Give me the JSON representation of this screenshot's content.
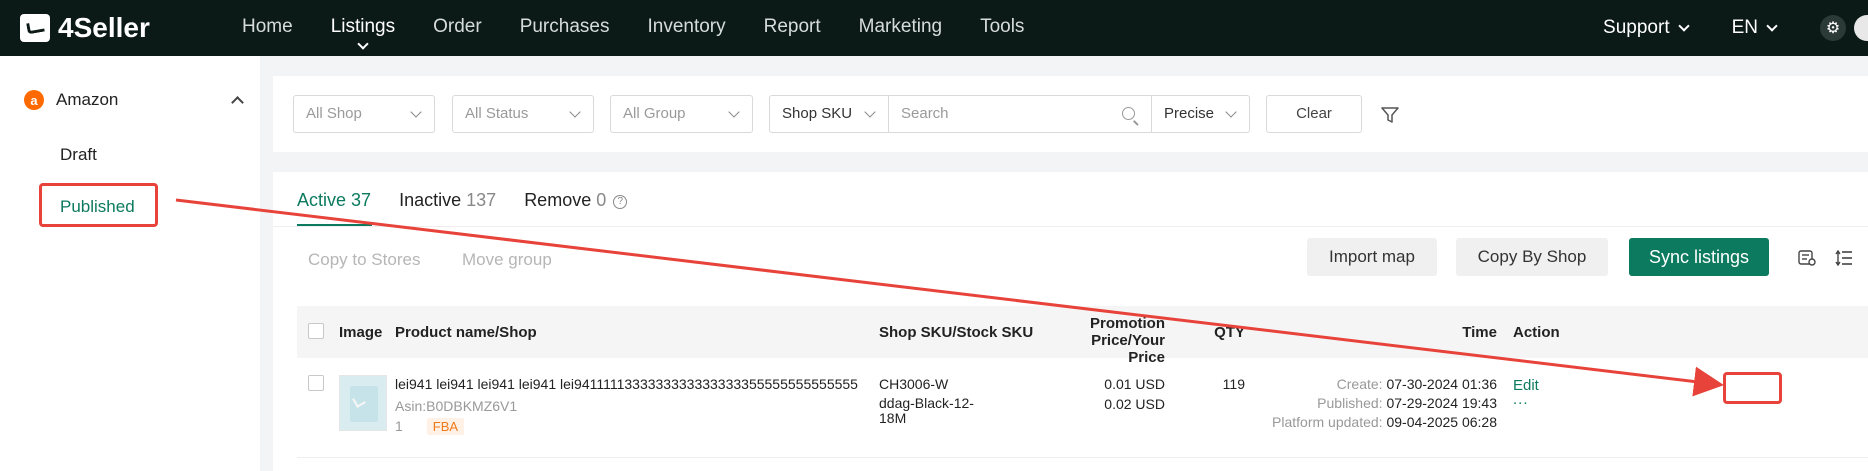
{
  "topbar": {
    "brand": "4Seller",
    "nav": [
      "Home",
      "Listings",
      "Order",
      "Purchases",
      "Inventory",
      "Report",
      "Marketing",
      "Tools"
    ],
    "active_nav": "Listings",
    "support": "Support",
    "language": "EN"
  },
  "sidebar": {
    "marketplace": "Amazon",
    "marketplace_icon": "a",
    "items": [
      "Draft",
      "Published"
    ],
    "active_item": "Published"
  },
  "filters": {
    "shop": "All Shop",
    "status": "All Status",
    "group": "All Group",
    "search_field": "Shop SKU",
    "search_placeholder": "Search",
    "match_mode": "Precise",
    "clear_label": "Clear"
  },
  "tabs": [
    {
      "label": "Active",
      "count": "37"
    },
    {
      "label": "Inactive",
      "count": "137"
    },
    {
      "label": "Remove",
      "count": "0"
    }
  ],
  "actions": {
    "copy_to_stores": "Copy to Stores",
    "move_group": "Move group",
    "import_map": "Import map",
    "copy_by_shop": "Copy By Shop",
    "sync_listings": "Sync listings"
  },
  "table": {
    "headers": {
      "image": "Image",
      "product": "Product name/Shop",
      "sku": "Shop SKU/Stock SKU",
      "price_line1": "Promotion Price/Your",
      "price_line2": "Price",
      "qty": "QTY",
      "time": "Time",
      "action": "Action"
    },
    "rows": [
      {
        "name": "lei941 lei941 lei941 lei941 lei9411111333333333333333355555555555555",
        "asin": "Asin:B0DBKMZ6V1",
        "shop_num": "1",
        "fulfillment": "FBA",
        "shop_sku": "CH3006-W",
        "stock_sku_line1": "ddag-Black-12-",
        "stock_sku_line2": "18M",
        "promo_price": "0.01 USD",
        "your_price": "0.02 USD",
        "qty": "119",
        "create_label": "Create:",
        "create_time": "07-30-2024 01:36",
        "published_label": "Published:",
        "published_time": "07-29-2024 19:43",
        "platform_label": "Platform updated:",
        "platform_time": "09-04-2025 06:28",
        "edit_label": "Edit",
        "more_label": "..."
      }
    ]
  },
  "colors": {
    "accent": "#0b7a5e",
    "topbar": "#0c1a17",
    "annotation": "#e8433a",
    "fba": "#f07a1a"
  }
}
